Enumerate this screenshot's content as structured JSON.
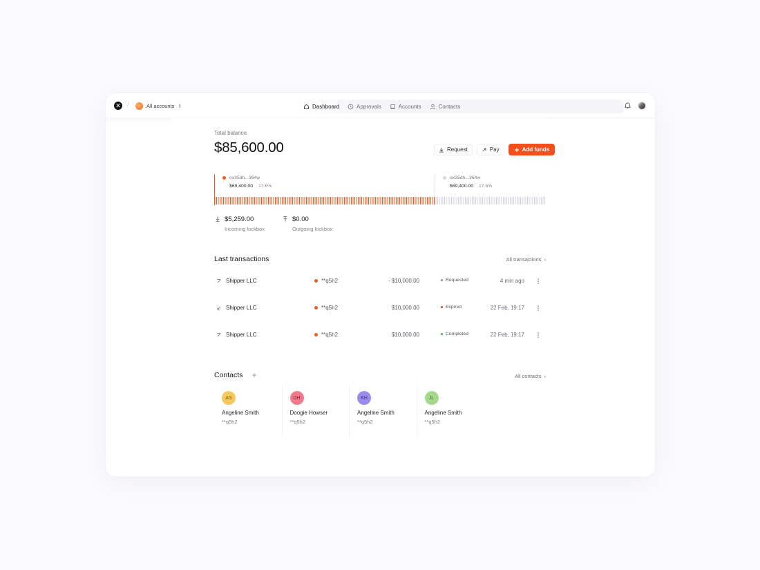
{
  "topbar": {
    "account_switcher_label": "All accounts",
    "nav": [
      {
        "label": "Dashboard",
        "icon": "home-icon",
        "active": true
      },
      {
        "label": "Approvals",
        "icon": "clock-icon",
        "active": false
      },
      {
        "label": "Accounts",
        "icon": "book-icon",
        "active": false
      },
      {
        "label": "Contacts",
        "icon": "user-icon",
        "active": false
      }
    ]
  },
  "balance": {
    "label": "Total balance",
    "value": "$85,600.00"
  },
  "actions": {
    "request_label": "Request",
    "pay_label": "Pay",
    "add_funds_label": "Add funds"
  },
  "accounts": [
    {
      "address": "ox35dh...364w",
      "amount": "$69,400.00",
      "percent": "17.6%",
      "color": "#f05a1f"
    },
    {
      "address": "ox35dh...364w",
      "amount": "$69,400.00",
      "percent": "17.6%",
      "color": "#d3d0dc"
    }
  ],
  "balance_split_fraction": 0.665,
  "lockbox": {
    "incoming": {
      "value": "$5,259.00",
      "label": "Incoming lockbox"
    },
    "outgoing": {
      "value": "$0.00",
      "label": "Outgoing lockbox"
    }
  },
  "transactions": {
    "title": "Last transactions",
    "all_link": "All transactions",
    "rows": [
      {
        "name": "Shipper LLC",
        "account": "**q5h2",
        "amount": "- $10,000.00",
        "status": "Requested",
        "status_color": "#8c8c94",
        "time": "4 min ago",
        "direction": "outgoing"
      },
      {
        "name": "Shipper LLC",
        "account": "**q5h2",
        "amount": "$10,000.00",
        "status": "Expired",
        "status_color": "#e0352b",
        "time": "22 Feb, 19:17",
        "direction": "incoming"
      },
      {
        "name": "Shipper LLC",
        "account": "**q5h2",
        "amount": "$10,000.00",
        "status": "Completed",
        "status_color": "#3cb055",
        "time": "22 Feb, 19:17",
        "direction": "outgoing"
      }
    ]
  },
  "contacts": {
    "title": "Contacts",
    "all_link": "All contacts",
    "items": [
      {
        "initials": "AS",
        "name": "Angeline Smith",
        "account": "**q5h2",
        "bg": "#f6c95e",
        "fg": "#8a5a0a"
      },
      {
        "initials": "DH",
        "name": "Doogie Howser",
        "account": "**q5h2",
        "bg": "#f07a8c",
        "fg": "#8a1a2a"
      },
      {
        "initials": "KH",
        "name": "Angeline Smith",
        "account": "**q5h2",
        "bg": "#9b8cec",
        "fg": "#3b2c8a"
      },
      {
        "initials": "JL",
        "name": "Angeline Smith",
        "account": "**q5h2",
        "bg": "#a5d88c",
        "fg": "#3d6b2a"
      }
    ]
  }
}
